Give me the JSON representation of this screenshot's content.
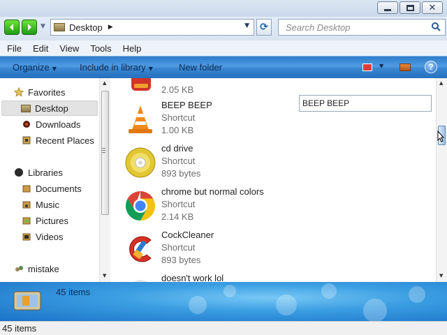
{
  "address": {
    "location": "Desktop"
  },
  "search": {
    "placeholder": "Search Desktop"
  },
  "menu": [
    "File",
    "Edit",
    "View",
    "Tools",
    "Help"
  ],
  "commands": {
    "organize": "Organize",
    "include": "Include in library",
    "new_folder": "New folder"
  },
  "nav": {
    "favorites": {
      "label": "Favorites",
      "items": [
        "Desktop",
        "Downloads",
        "Recent Places"
      ]
    },
    "libraries": {
      "label": "Libraries",
      "items": [
        "Documents",
        "Music",
        "Pictures",
        "Videos"
      ]
    },
    "other": "mistake"
  },
  "files": [
    {
      "name": "",
      "type": "",
      "size": "2.05 KB",
      "icon": "app-icon"
    },
    {
      "name": "BEEP BEEP",
      "type": "Shortcut",
      "size": "1.00 KB",
      "icon": "vlc-cone-icon"
    },
    {
      "name": "cd drive",
      "type": "Shortcut",
      "size": "893 bytes",
      "icon": "cd-disc-icon"
    },
    {
      "name": "chrome but normal colors",
      "type": "Shortcut",
      "size": "2.14 KB",
      "icon": "chrome-icon"
    },
    {
      "name": "CockCleaner",
      "type": "Shortcut",
      "size": "893 bytes",
      "icon": "ccleaner-icon"
    },
    {
      "name": "doesn't work lol",
      "type": "",
      "size": "",
      "icon": "blank-icon"
    }
  ],
  "rename_box": {
    "value": "BEEP BEEP"
  },
  "details": {
    "count": "45 items"
  },
  "status": {
    "text": "45 items"
  },
  "colors": {
    "command_bar": "#3a87d2",
    "details_pane": "#3b9ee2",
    "nav_arrows": "#1f9a12"
  }
}
